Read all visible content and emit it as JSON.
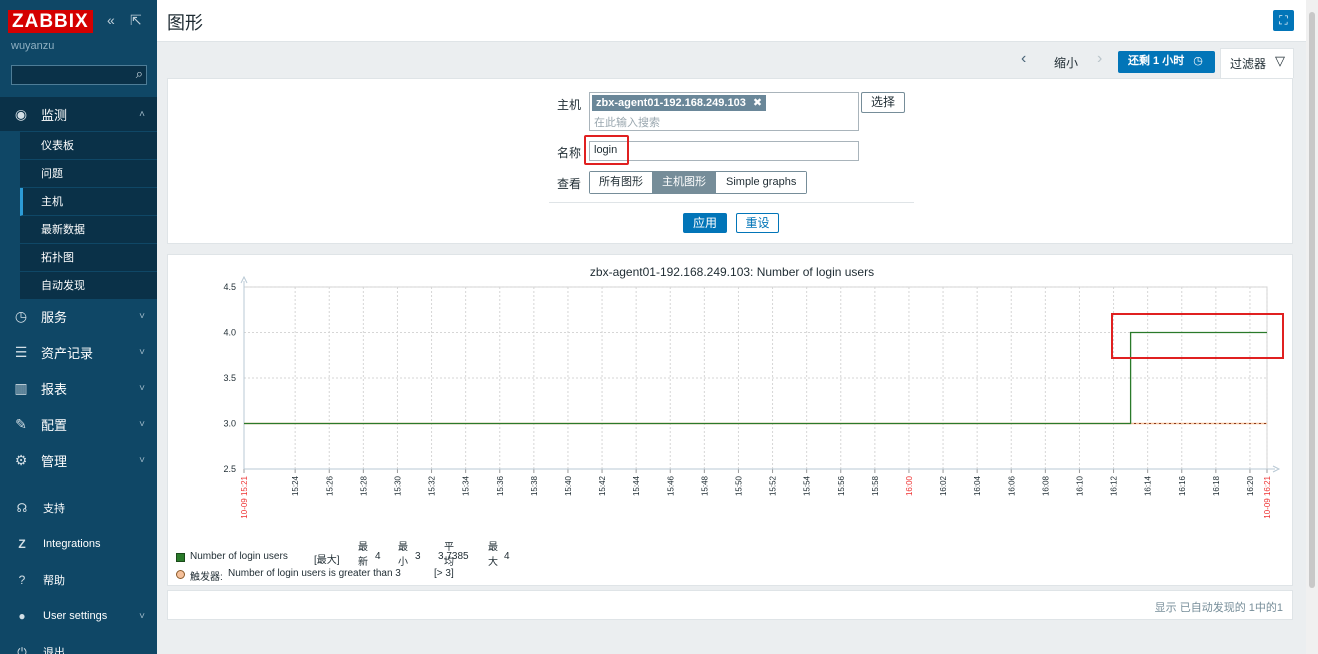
{
  "app": {
    "logo": "ZABBIX",
    "username": "wuyanzu",
    "page_title": "图形"
  },
  "sidebar": {
    "main_items": [
      {
        "label": "监测",
        "icon": "eye-icon"
      },
      {
        "label": "服务",
        "icon": "clock-icon"
      },
      {
        "label": "资产记录",
        "icon": "list-icon"
      },
      {
        "label": "报表",
        "icon": "bar-chart-icon"
      },
      {
        "label": "配置",
        "icon": "wrench-icon"
      },
      {
        "label": "管理",
        "icon": "gear-icon"
      }
    ],
    "sub_items": [
      "仪表板",
      "问题",
      "主机",
      "最新数据",
      "拓扑图",
      "自动发现"
    ],
    "bottom_items": [
      {
        "label": "支持",
        "icon": "support-icon"
      },
      {
        "label": "Integrations",
        "icon": "integrations-icon"
      },
      {
        "label": "帮助",
        "icon": "help-icon"
      },
      {
        "label": "User settings",
        "icon": "user-icon"
      },
      {
        "label": "退出",
        "icon": "power-icon"
      }
    ]
  },
  "toolbar": {
    "zoom_out": "缩小",
    "time_range": "还剩 1 小时",
    "filter": "过滤器"
  },
  "filter": {
    "host_label": "主机",
    "host_tag": "zbx-agent01-192.168.249.103",
    "host_placeholder": "在此输入搜索",
    "select_button": "选择",
    "name_label": "名称",
    "name_value": "login",
    "view_label": "查看",
    "view_options": [
      "所有图形",
      "主机图形",
      "Simple graphs"
    ],
    "view_selected": "主机图形",
    "apply": "应用",
    "reset": "重设"
  },
  "graph": {
    "legend_headers": [
      "最新",
      "最小",
      "平均",
      "最大"
    ],
    "series_name": "Number of login users",
    "series_func": "[最大]",
    "series_stats": [
      "4",
      "3",
      "3.7385",
      "4"
    ],
    "trigger_label": "触发器:",
    "trigger_text": "Number of login users is greater than 3",
    "trigger_cond": "[> 3]",
    "series_color": "#2a7a2a",
    "trigger_color": "#f5c09a"
  },
  "chart_data": {
    "type": "line",
    "title": "zbx-agent01-192.168.249.103: Number of login users",
    "x_start_label": "10-09 15:21",
    "x_end_label": "10-09 16:21",
    "x_ticks": [
      "15:24",
      "15:26",
      "15:28",
      "15:30",
      "15:32",
      "15:34",
      "15:36",
      "15:38",
      "15:40",
      "15:42",
      "15:44",
      "15:46",
      "15:48",
      "15:50",
      "15:52",
      "15:54",
      "15:56",
      "15:58",
      "16:00",
      "16:02",
      "16:04",
      "16:06",
      "16:08",
      "16:10",
      "16:12",
      "16:14",
      "16:16",
      "16:18",
      "16:20"
    ],
    "y_ticks": [
      "4.5",
      "4.0",
      "3.5",
      "3.0",
      "2.5"
    ],
    "ylim": [
      2.5,
      4.5
    ],
    "series": [
      {
        "name": "Number of login users",
        "x": [
          "15:21",
          "16:13",
          "16:13",
          "16:21"
        ],
        "values": [
          3,
          3,
          4,
          4
        ]
      }
    ],
    "trigger_threshold": 3
  },
  "paging": {
    "text": "显示 已自动发现的 1中的1"
  }
}
